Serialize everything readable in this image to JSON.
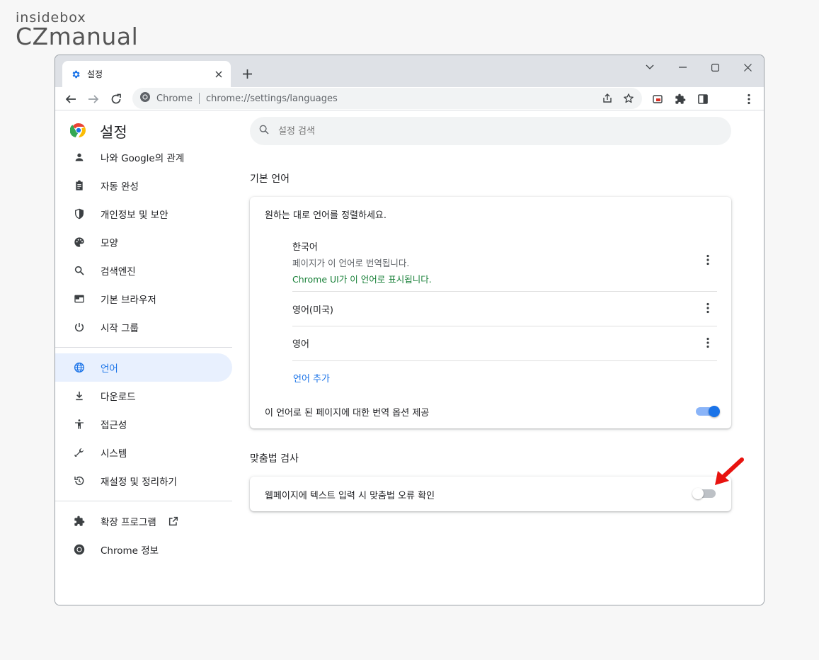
{
  "watermark": {
    "top": "insidebox",
    "bottom": "CZmanual"
  },
  "window": {
    "tab_title": "설정",
    "omnibox_site": "Chrome",
    "omnibox_url": "chrome://settings/languages"
  },
  "sidebar": {
    "title": "설정",
    "items": [
      {
        "label": "나와 Google의 관계",
        "icon": "person-icon"
      },
      {
        "label": "자동 완성",
        "icon": "clipboard-icon"
      },
      {
        "label": "개인정보 및 보안",
        "icon": "shield-icon"
      },
      {
        "label": "모양",
        "icon": "palette-icon"
      },
      {
        "label": "검색엔진",
        "icon": "search-icon"
      },
      {
        "label": "기본 브라우저",
        "icon": "browser-icon"
      },
      {
        "label": "시작 그룹",
        "icon": "power-icon"
      },
      {
        "label": "언어",
        "icon": "globe-icon",
        "active": true
      },
      {
        "label": "다운로드",
        "icon": "download-icon"
      },
      {
        "label": "접근성",
        "icon": "accessibility-icon"
      },
      {
        "label": "시스템",
        "icon": "wrench-icon"
      },
      {
        "label": "재설정 및 정리하기",
        "icon": "restore-icon"
      },
      {
        "label": "확장 프로그램",
        "icon": "puzzle-icon"
      },
      {
        "label": "Chrome 정보",
        "icon": "chrome-icon"
      }
    ]
  },
  "search": {
    "placeholder": "설정 검색"
  },
  "languages": {
    "section_title": "기본 언어",
    "description": "원하는 대로 언어를 정렬하세요.",
    "list": [
      {
        "name": "한국어",
        "sub1": "페이지가 이 언어로 번역됩니다.",
        "sub2": "Chrome UI가 이 언어로 표시됩니다."
      },
      {
        "name": "영어(미국)"
      },
      {
        "name": "영어"
      }
    ],
    "add_language": "언어 추가",
    "translate_offer_label": "이 언어로 된 페이지에 대한 번역 옵션 제공",
    "translate_offer_enabled": true
  },
  "spellcheck": {
    "section_title": "맞춤법 검사",
    "label": "웹페이지에 텍스트 입력 시 맞춤법 오류 확인",
    "enabled": false
  },
  "colors": {
    "accent": "#1a73e8",
    "annotation_arrow": "#e8130f"
  }
}
